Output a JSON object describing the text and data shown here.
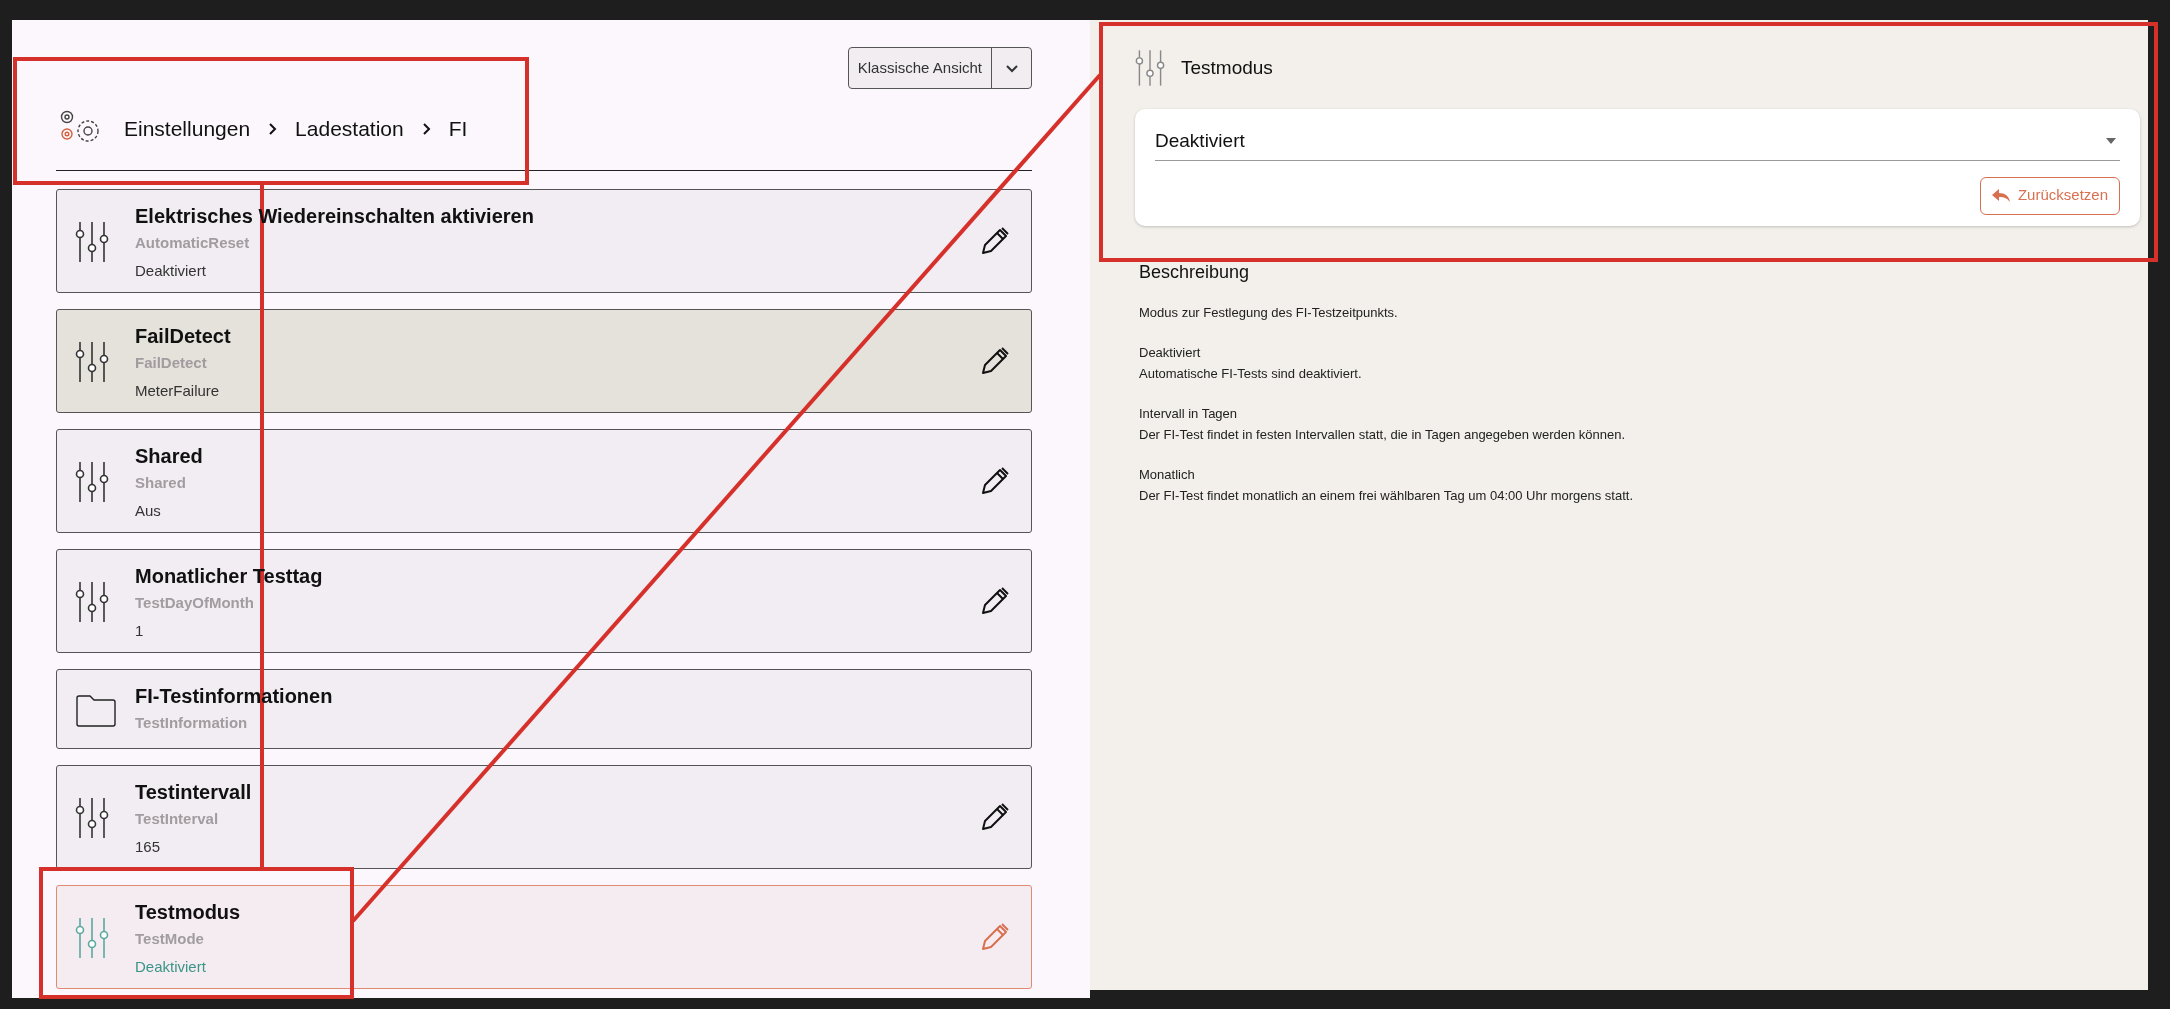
{
  "view_switch": {
    "label": "Klassische Ansicht"
  },
  "breadcrumb": [
    "Einstellungen",
    "Ladestation",
    "FI"
  ],
  "settings": [
    {
      "kind": "setting",
      "title": "Elektrisches Wiedereinschalten aktivieren",
      "key": "AutomaticReset",
      "value": "Deaktiviert",
      "selected": false,
      "highlighted": false
    },
    {
      "kind": "setting",
      "title": "FailDetect",
      "key": "FailDetect",
      "value": "MeterFailure",
      "selected": false,
      "highlighted": true
    },
    {
      "kind": "setting",
      "title": "Shared",
      "key": "Shared",
      "value": "Aus",
      "selected": false,
      "highlighted": false
    },
    {
      "kind": "setting",
      "title": "Monatlicher Testtag",
      "key": "TestDayOfMonth",
      "value": "1",
      "selected": false,
      "highlighted": false
    },
    {
      "kind": "folder",
      "title": "FI-Testinformationen",
      "key": "TestInformation",
      "selected": false,
      "highlighted": false
    },
    {
      "kind": "setting",
      "title": "Testintervall",
      "key": "TestInterval",
      "value": "165",
      "selected": false,
      "highlighted": false
    },
    {
      "kind": "setting",
      "title": "Testmodus",
      "key": "TestMode",
      "value": "Deaktiviert",
      "selected": true,
      "highlighted": false
    }
  ],
  "detail": {
    "title": "Testmodus",
    "select_value": "Deaktiviert",
    "reset_button": "Zurücksetzen",
    "description_heading": "Beschreibung",
    "description": [
      {
        "lines": [
          "Modus zur Festlegung des FI-Testzeitpunkts."
        ]
      },
      {
        "lines": [
          "Deaktiviert",
          "Automatische FI-Tests sind deaktiviert."
        ]
      },
      {
        "lines": [
          "Intervall in Tagen",
          "Der FI-Test findet in festen Intervallen statt, die in Tagen angegeben werden können."
        ]
      },
      {
        "lines": [
          "Monatlich",
          "Der FI-Test findet monatlich an einem frei wählbaren Tag um 04:00 Uhr morgens statt."
        ]
      }
    ]
  }
}
